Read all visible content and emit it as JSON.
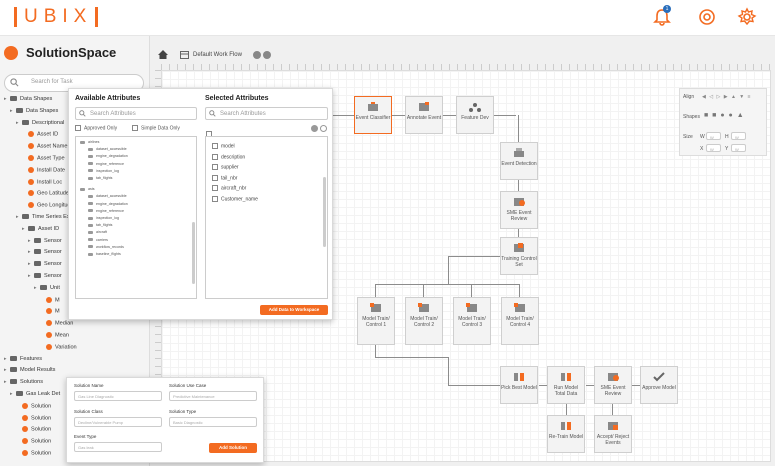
{
  "app": {
    "logo_text": "UBIX",
    "notification_count": "1",
    "brand_color": "#f36b21"
  },
  "sidebar": {
    "title": "SolutionSpace",
    "search_placeholder": "Search for Task",
    "tree": [
      {
        "label": "Data Shapes",
        "type": "folder",
        "indent": 0
      },
      {
        "label": "Data Shapes",
        "type": "folder",
        "indent": 1
      },
      {
        "label": "Descriptional",
        "type": "folder",
        "indent": 2
      },
      {
        "label": "Asset ID",
        "type": "dot",
        "indent": 3
      },
      {
        "label": "Asset Name",
        "type": "dot",
        "indent": 3
      },
      {
        "label": "Asset Type",
        "type": "dot",
        "indent": 3
      },
      {
        "label": "Install Date",
        "type": "dot",
        "indent": 3
      },
      {
        "label": "Install Loc",
        "type": "dot",
        "indent": 3
      },
      {
        "label": "Geo Latitude",
        "type": "dot",
        "indent": 3
      },
      {
        "label": "Geo Longitude",
        "type": "dot",
        "indent": 3
      },
      {
        "label": "Time Series Ex",
        "type": "folder",
        "indent": 2
      },
      {
        "label": "Asset ID",
        "type": "folder",
        "indent": 3
      },
      {
        "label": "Sensor",
        "type": "folder",
        "indent": 4
      },
      {
        "label": "Sensor",
        "type": "folder",
        "indent": 4
      },
      {
        "label": "Sensor",
        "type": "folder",
        "indent": 4
      },
      {
        "label": "Sensor",
        "type": "folder",
        "indent": 4
      },
      {
        "label": "Unit",
        "type": "folder",
        "indent": 5
      },
      {
        "label": "M",
        "type": "dot",
        "indent": 6
      },
      {
        "label": "M",
        "type": "dot",
        "indent": 6
      },
      {
        "label": "Median",
        "type": "dot",
        "indent": 6
      },
      {
        "label": "Mean",
        "type": "dot",
        "indent": 6
      },
      {
        "label": "Variation",
        "type": "dot",
        "indent": 6
      },
      {
        "label": "Features",
        "type": "folder",
        "indent": 0
      },
      {
        "label": "Model Results",
        "type": "folder",
        "indent": 0
      },
      {
        "label": "Solutions",
        "type": "folder",
        "indent": 0
      },
      {
        "label": "Gas Leak Det",
        "type": "folder",
        "indent": 1
      },
      {
        "label": "Solution",
        "type": "dot",
        "indent": 2
      },
      {
        "label": "Solution",
        "type": "dot",
        "indent": 2
      },
      {
        "label": "Solution",
        "type": "dot",
        "indent": 2
      },
      {
        "label": "Solution",
        "type": "dot",
        "indent": 2
      },
      {
        "label": "Solution",
        "type": "dot",
        "indent": 2
      }
    ]
  },
  "workspace": {
    "tab_label": "Default Work Flow"
  },
  "attributes_popup": {
    "available_title": "Available Attributes",
    "selected_title": "Selected Attributes",
    "search_placeholder": "Search Attributes",
    "approved_only": "Approved Only",
    "simple_data_only": "Simple Data Only",
    "available_tree": [
      "airlines",
      "dataset_accessible",
      "engine_degradation",
      "engine_reference",
      "inspection_log",
      "tab_flights",
      "asts",
      "dataset_accessible",
      "engine_degradation",
      "engine_reference",
      "inspection_log",
      "tab_flights",
      "aircraft",
      "carriers",
      "workflow_records",
      "baseline_flights"
    ],
    "selected_items": [
      "model",
      "description",
      "supplier",
      "tail_nbr",
      "aircraft_nbr",
      "Customer_name"
    ],
    "add_button": "Add Data to Workspace"
  },
  "solution_form": {
    "solution_name_label": "Solution Name",
    "solution_name_placeholder": "Gas Line Diagnostic",
    "solution_use_case_label": "Solution Use Case",
    "solution_use_case_placeholder": "Predictive Maintenance",
    "solution_class_label": "Solution Class",
    "solution_class_placeholder": "Decline/Vulnerable Pump",
    "solution_type_label": "Solution Type",
    "solution_type_placeholder": "Basic Diagnostic",
    "event_type_label": "Event Type",
    "event_type_placeholder": "Gas leak",
    "add_button": "Add Solution"
  },
  "align_panel": {
    "align_label": "Align",
    "shapes_label": "Shapes",
    "size_label": "Size",
    "w_label": "W",
    "h_label": "H",
    "x_label": "X",
    "y_label": "Y",
    "w_value": "W",
    "h_value": "W",
    "x_value": "W",
    "y_value": "W"
  },
  "nodes": {
    "event_classifier": "Event Classifier",
    "annotate_event": "Annotate Event",
    "feature_dev": "Feature Dev",
    "event_detection": "Event Detection",
    "sme_event_review": "SME Event Review",
    "training_control_set": "Training Control Set",
    "model_train_1": "Model Train/ Control 1",
    "model_train_2": "Model Train/ Control 2",
    "model_train_3": "Model Train/ Control 3",
    "model_train_4": "Model Train/ Control 4",
    "pick_best_model": "Pick Best Model",
    "run_model": "Run Model Total Data",
    "sme_event_review_2": "SME Event Review",
    "approve_model": "Approve Model",
    "retrain_model": "Re-Train Model",
    "accept_reject": "Accept/ Reject Events"
  }
}
